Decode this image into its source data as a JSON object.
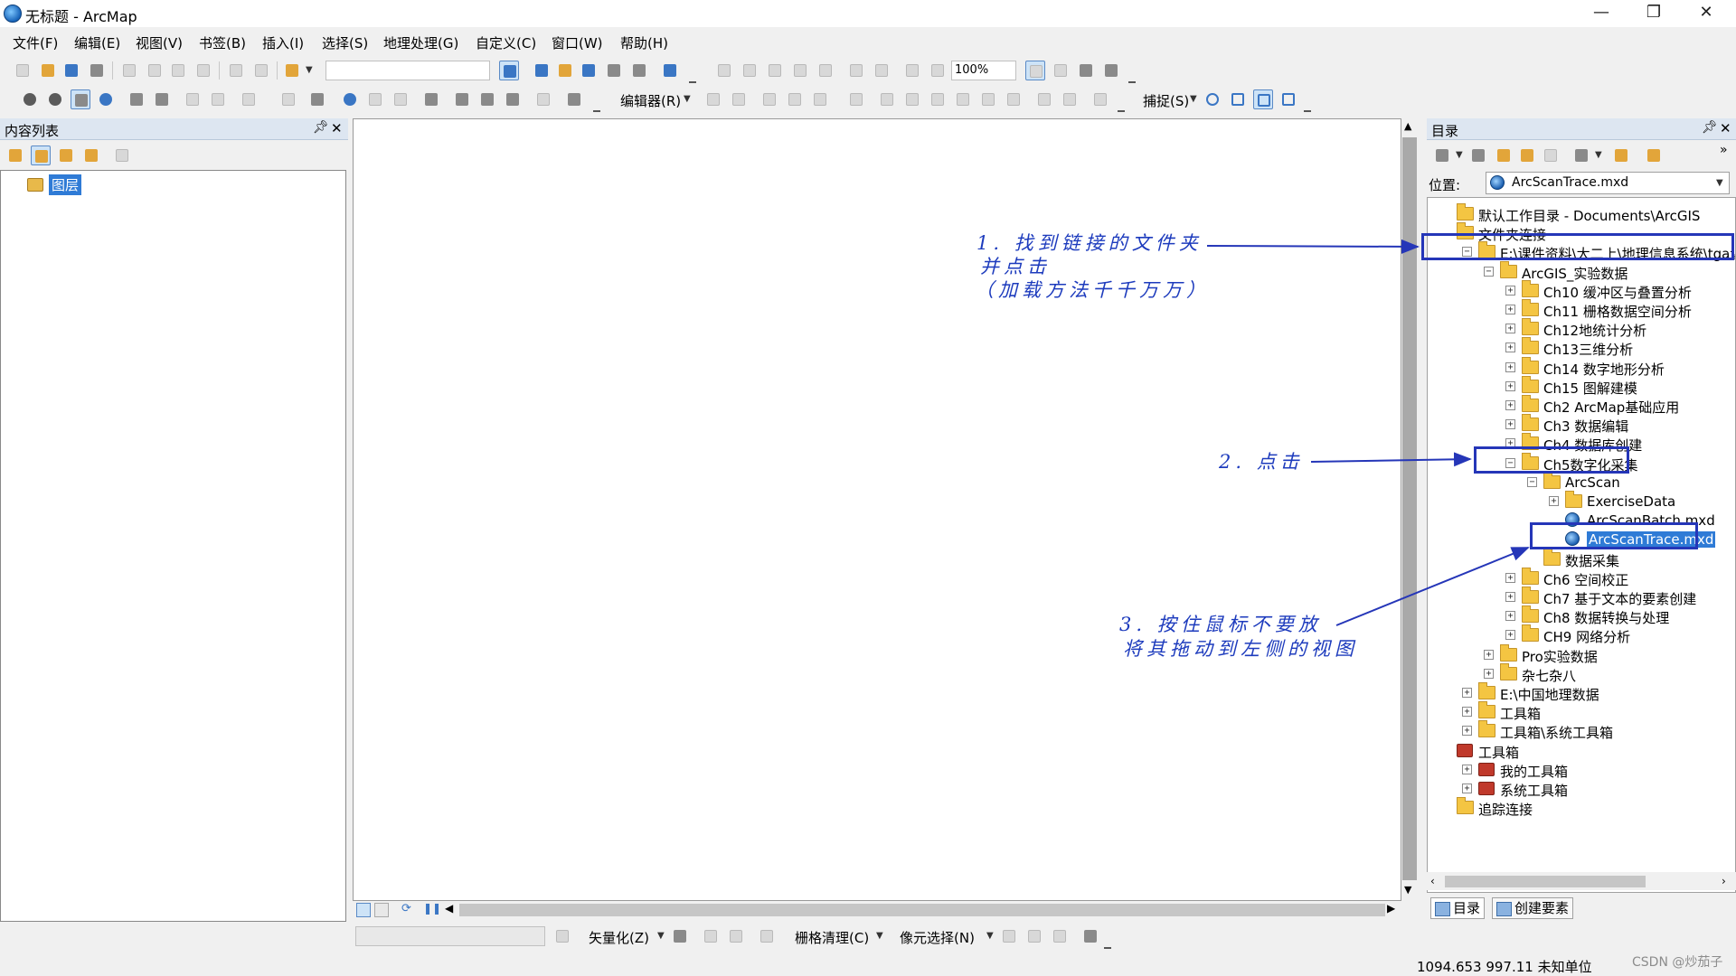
{
  "window": {
    "title": "无标题 - ArcMap",
    "controls": {
      "minimize": "—",
      "maximize": "❐",
      "close": "✕"
    }
  },
  "menu": [
    "文件(F)",
    "编辑(E)",
    "视图(V)",
    "书签(B)",
    "插入(I)",
    "选择(S)",
    "地理处理(G)",
    "自定义(C)",
    "窗口(W)",
    "帮助(H)"
  ],
  "toolbar": {
    "scale_value": "",
    "zoom_value": "100%",
    "editor_label": "编辑器(R)",
    "snapping_label": "捕捉(S)"
  },
  "toc": {
    "title": "内容列表",
    "layers_label": "图层"
  },
  "catalog": {
    "title": "目录",
    "location_label": "位置:",
    "location_value": "ArcScanTrace.mxd",
    "tree": [
      {
        "label": "默认工作目录 - Documents\\ArcGIS",
        "icon": "folder-icon",
        "pm": ""
      },
      {
        "label": "文件夹连接",
        "icon": "folder-icon",
        "pm": ""
      },
      {
        "label": "E:\\课件资料\\大二上\\地理信息系统\\tga课",
        "icon": "folder-icon",
        "pm": "−"
      },
      {
        "label": "ArcGIS_实验数据",
        "icon": "folder-icon",
        "pm": "−"
      },
      {
        "label": "Ch10 缓冲区与叠置分析",
        "icon": "folder-icon",
        "pm": "+"
      },
      {
        "label": "Ch11 栅格数据空间分析",
        "icon": "folder-icon",
        "pm": "+"
      },
      {
        "label": "Ch12地统计分析",
        "icon": "folder-icon",
        "pm": "+"
      },
      {
        "label": "Ch13三维分析",
        "icon": "folder-icon",
        "pm": "+"
      },
      {
        "label": "Ch14 数字地形分析",
        "icon": "folder-icon",
        "pm": "+"
      },
      {
        "label": "Ch15 图解建模",
        "icon": "folder-icon",
        "pm": "+"
      },
      {
        "label": "Ch2 ArcMap基础应用",
        "icon": "folder-icon",
        "pm": "+"
      },
      {
        "label": "Ch3 数据编辑",
        "icon": "folder-icon",
        "pm": "+"
      },
      {
        "label": "Ch4 数据库创建",
        "icon": "folder-icon",
        "pm": "+"
      },
      {
        "label": "Ch5数字化采集",
        "icon": "folder-icon",
        "pm": "−"
      },
      {
        "label": "ArcScan",
        "icon": "folder-icon",
        "pm": "−"
      },
      {
        "label": "ExerciseData",
        "icon": "folder-icon",
        "pm": "+"
      },
      {
        "label": "ArcScanBatch.mxd",
        "icon": "map-document-icon",
        "pm": ""
      },
      {
        "label": "ArcScanTrace.mxd",
        "icon": "map-document-icon",
        "pm": ""
      },
      {
        "label": "数据采集",
        "icon": "folder-icon",
        "pm": ""
      },
      {
        "label": "Ch6 空间校正",
        "icon": "folder-icon",
        "pm": "+"
      },
      {
        "label": "Ch7 基于文本的要素创建",
        "icon": "folder-icon",
        "pm": "+"
      },
      {
        "label": "Ch8 数据转换与处理",
        "icon": "folder-icon",
        "pm": "+"
      },
      {
        "label": "CH9 网络分析",
        "icon": "folder-icon",
        "pm": "+"
      },
      {
        "label": "Pro实验数据",
        "icon": "folder-icon",
        "pm": "+"
      },
      {
        "label": "杂七杂八",
        "icon": "folder-icon",
        "pm": "+"
      },
      {
        "label": "E:\\中国地理数据",
        "icon": "folder-icon",
        "pm": "+"
      },
      {
        "label": "工具箱",
        "icon": "folder-icon",
        "pm": "+"
      },
      {
        "label": "工具箱\\系统工具箱",
        "icon": "folder-icon",
        "pm": "+"
      },
      {
        "label": "工具箱",
        "icon": "toolbox-icon",
        "pm": ""
      },
      {
        "label": "我的工具箱",
        "icon": "toolbox-icon",
        "pm": "+"
      },
      {
        "label": "系统工具箱",
        "icon": "toolbox-icon",
        "pm": "+"
      },
      {
        "label": "追踪连接",
        "icon": "folder-icon",
        "pm": ""
      }
    ],
    "tabs": [
      "目录",
      "创建要素"
    ]
  },
  "arcscan_toolbar": {
    "vectorize_label": "矢量化(Z)",
    "raster_cleanup_label": "栅格清理(C)",
    "cell_select_label": "像元选择(N)"
  },
  "status": {
    "coords": "1094.653  997.11 未知单位",
    "watermark": "CSDN @炒茄子"
  },
  "annotations": {
    "step1_line1": "1. 找到链接的文件夹",
    "step1_line2": "并点击",
    "step1_line3": "（加载方法千千万万）",
    "step2": "2. 点击",
    "step3_line1": "3. 按住鼠标不要放",
    "step3_line2": "将其拖动到左侧的视图"
  },
  "colors": {
    "annotation": "#1d3bbd",
    "highlight_border": "#2536b8",
    "selection": "#2f7bd6",
    "panel_header": "#dde6f1"
  }
}
